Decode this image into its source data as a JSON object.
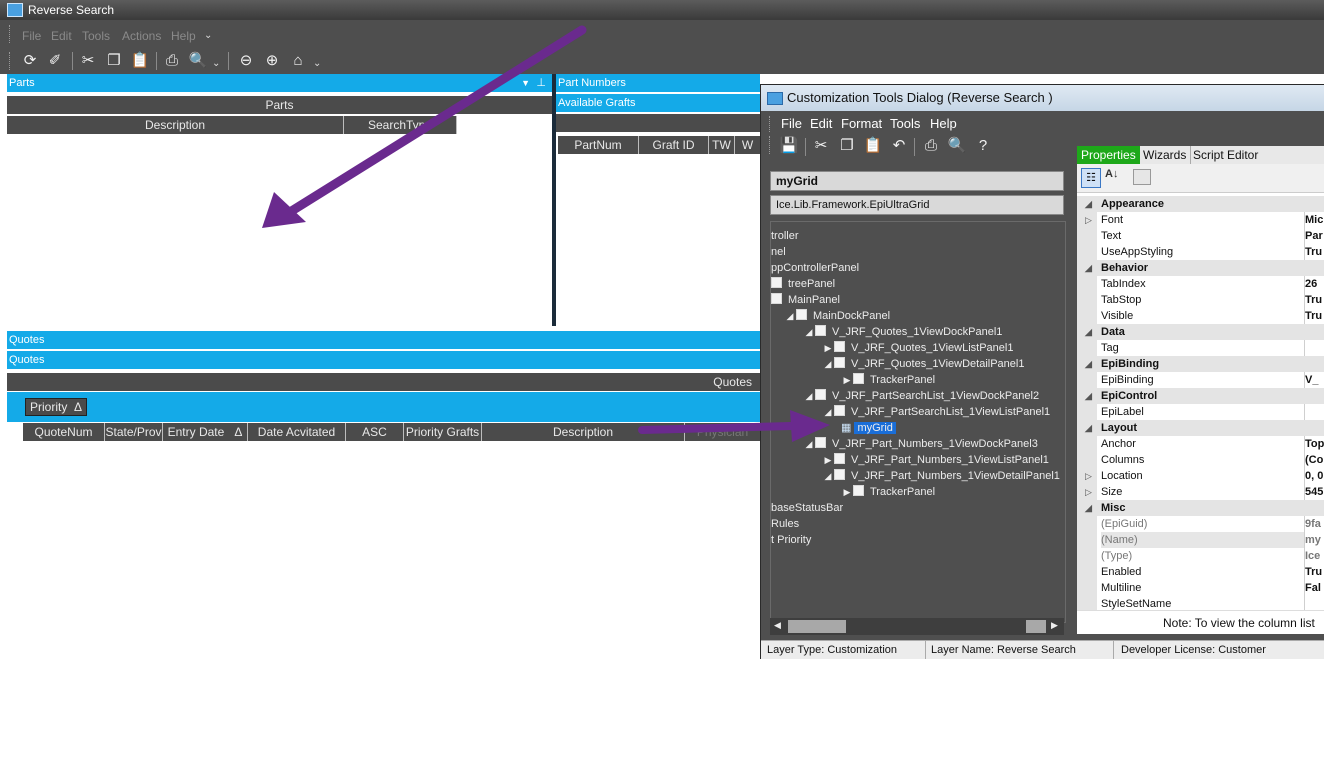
{
  "window": {
    "title": "Reverse Search"
  },
  "menu": [
    "File",
    "Edit",
    "Tools",
    "Actions",
    "Help"
  ],
  "left": {
    "parts_header": "Parts",
    "parts_group": "Parts",
    "parts_cols": [
      "Description",
      "SearchType"
    ],
    "partnum_header": "Part Numbers",
    "grafts_header": "Available Grafts",
    "grafts_cols": [
      "PartNum",
      "Graft ID",
      "TW",
      "W"
    ],
    "quotes_header1": "Quotes",
    "quotes_header2": "Quotes",
    "quotes_group": "Quotes",
    "group_chip": "Priority",
    "quotes_cols": [
      "QuoteNum",
      "State/Prov",
      "Entry Date",
      "Date Acvitated",
      "ASC",
      "Priority Grafts",
      "Description",
      "Physician"
    ]
  },
  "dialog": {
    "title": "Customization Tools Dialog  (Reverse Search )",
    "menu": [
      "File",
      "Edit",
      "Format",
      "Tools",
      "Help"
    ],
    "selected_name": "myGrid",
    "selected_type": "Ice.Lib.Framework.EpiUltraGrid",
    "tree": [
      {
        "label": "troller",
        "indent": 0,
        "box": false,
        "tri": ""
      },
      {
        "label": "nel",
        "indent": 0,
        "box": false,
        "tri": ""
      },
      {
        "label": "ppControllerPanel",
        "indent": 0,
        "box": false,
        "tri": ""
      },
      {
        "label": "treePanel",
        "indent": 0,
        "box": true,
        "tri": ""
      },
      {
        "label": "MainPanel",
        "indent": 0,
        "box": true,
        "tri": ""
      },
      {
        "label": "MainDockPanel",
        "indent": 1,
        "box": true,
        "tri": "◢"
      },
      {
        "label": "V_JRF_Quotes_1ViewDockPanel1",
        "indent": 2,
        "box": true,
        "tri": "◢"
      },
      {
        "label": "V_JRF_Quotes_1ViewListPanel1",
        "indent": 3,
        "box": true,
        "tri": "▶"
      },
      {
        "label": "V_JRF_Quotes_1ViewDetailPanel1",
        "indent": 3,
        "box": true,
        "tri": "◢"
      },
      {
        "label": "TrackerPanel",
        "indent": 4,
        "box": true,
        "tri": "▶"
      },
      {
        "label": "V_JRF_PartSearchList_1ViewDockPanel2",
        "indent": 2,
        "box": true,
        "tri": "◢"
      },
      {
        "label": "V_JRF_PartSearchList_1ViewListPanel1",
        "indent": 3,
        "box": true,
        "tri": "◢"
      },
      {
        "label": "myGrid",
        "indent": 4,
        "box": false,
        "tri": "",
        "selected": true
      },
      {
        "label": "V_JRF_Part_Numbers_1ViewDockPanel3",
        "indent": 2,
        "box": true,
        "tri": "◢"
      },
      {
        "label": "V_JRF_Part_Numbers_1ViewListPanel1",
        "indent": 3,
        "box": true,
        "tri": "▶"
      },
      {
        "label": "V_JRF_Part_Numbers_1ViewDetailPanel1",
        "indent": 3,
        "box": true,
        "tri": "◢"
      },
      {
        "label": "TrackerPanel",
        "indent": 4,
        "box": true,
        "tri": "▶"
      },
      {
        "label": "baseStatusBar",
        "indent": 0,
        "box": false,
        "tri": ""
      },
      {
        "label": "Rules",
        "indent": 0,
        "box": false,
        "tri": ""
      },
      {
        "label": "t Priority",
        "indent": 0,
        "box": false,
        "tri": ""
      }
    ],
    "tabs": [
      "Properties",
      "Wizards",
      "Script Editor"
    ],
    "props": [
      {
        "cat": true,
        "name": "Appearance"
      },
      {
        "name": "Font",
        "value": "Mic",
        "exp": true
      },
      {
        "name": "Text",
        "value": "Par"
      },
      {
        "name": "UseAppStyling",
        "value": "Tru"
      },
      {
        "cat": true,
        "name": "Behavior"
      },
      {
        "name": "TabIndex",
        "value": "26"
      },
      {
        "name": "TabStop",
        "value": "Tru"
      },
      {
        "name": "Visible",
        "value": "Tru"
      },
      {
        "cat": true,
        "name": "Data"
      },
      {
        "name": "Tag",
        "value": ""
      },
      {
        "cat": true,
        "name": "EpiBinding"
      },
      {
        "name": "EpiBinding",
        "value": "V_"
      },
      {
        "cat": true,
        "name": "EpiControl"
      },
      {
        "name": "EpiLabel",
        "value": ""
      },
      {
        "cat": true,
        "name": "Layout"
      },
      {
        "name": "Anchor",
        "value": "Top"
      },
      {
        "name": "Columns",
        "value": "(Co"
      },
      {
        "name": "Location",
        "value": "0, 0",
        "exp": true
      },
      {
        "name": "Size",
        "value": "545",
        "exp": true
      },
      {
        "cat": true,
        "name": "Misc"
      },
      {
        "name": "(EpiGuid)",
        "value": "9fa",
        "dim": true
      },
      {
        "name": "(Name)",
        "value": "my",
        "dim": true,
        "shade": true
      },
      {
        "name": "(Type)",
        "value": "Ice",
        "dim": true
      },
      {
        "name": "Enabled",
        "value": "Tru"
      },
      {
        "name": "Multiline",
        "value": "Fal"
      },
      {
        "name": "StyleSetName",
        "value": ""
      }
    ],
    "note": "Note:  To view the column list",
    "status": {
      "layer_type": "Layer Type:  Customization",
      "layer_name": "Layer Name:  Reverse Search",
      "license": "Developer License:  Customer"
    }
  },
  "colors": {
    "accent": "#14aae8",
    "annotation_arrow": "#6a2a8e"
  }
}
